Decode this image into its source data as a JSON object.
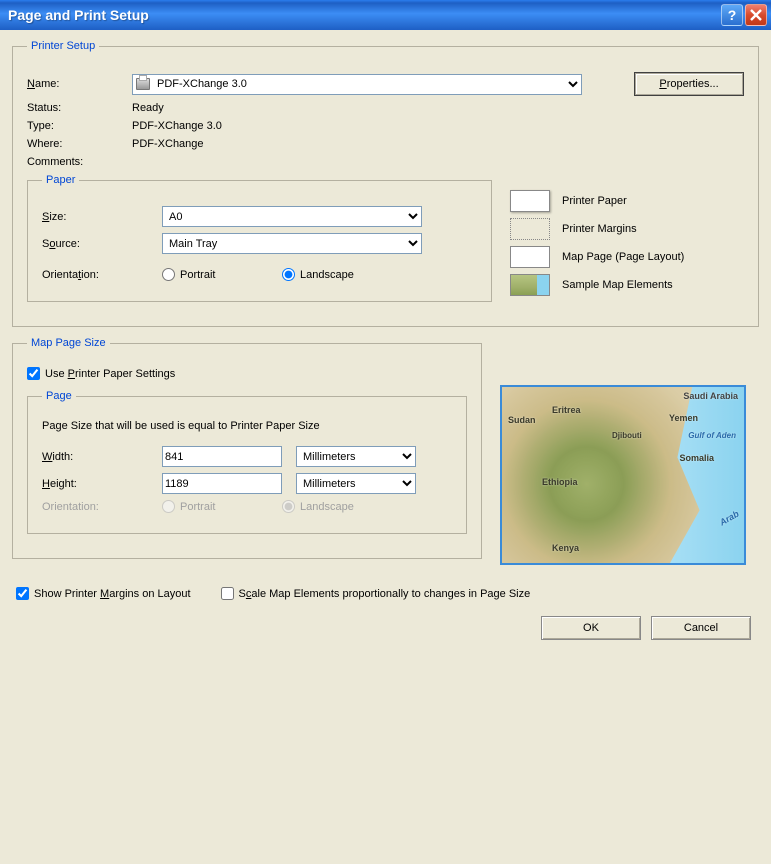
{
  "window": {
    "title": "Page and Print Setup"
  },
  "printer_setup": {
    "legend": "Printer Setup",
    "name_label": "Name:",
    "name_value": "PDF-XChange 3.0",
    "properties_button": "Properties...",
    "status_label": "Status:",
    "status_value": "Ready",
    "type_label": "Type:",
    "type_value": "PDF-XChange 3.0",
    "where_label": "Where:",
    "where_value": "PDF-XChange",
    "comments_label": "Comments:",
    "comments_value": ""
  },
  "paper": {
    "legend": "Paper",
    "size_label": "Size:",
    "size_value": "A0",
    "source_label": "Source:",
    "source_value": "Main Tray",
    "orientation_label": "Orientation:",
    "portrait_label": "Portrait",
    "landscape_label": "Landscape",
    "orientation_selected": "landscape"
  },
  "legend_panel": {
    "printer_paper": "Printer Paper",
    "printer_margins": "Printer Margins",
    "map_page": "Map Page (Page Layout)",
    "sample_map": "Sample Map Elements"
  },
  "map_page_size": {
    "legend": "Map Page Size",
    "use_printer_settings": "Use Printer Paper Settings",
    "use_printer_settings_checked": true,
    "page_legend": "Page",
    "page_hint": "Page Size that will be used is equal to Printer Paper Size",
    "width_label": "Width:",
    "width_value": "841",
    "width_unit": "Millimeters",
    "height_label": "Height:",
    "height_value": "1189",
    "height_unit": "Millimeters",
    "orientation_label": "Orientation:",
    "portrait_label": "Portrait",
    "landscape_label": "Landscape"
  },
  "map_preview": {
    "labels": [
      "Saudi Arabia",
      "Eritrea",
      "Sudan",
      "Yemen",
      "Djibouti",
      "Gulf of Aden",
      "Somalia",
      "Ethiopia",
      "Kenya",
      "Arab"
    ]
  },
  "bottom": {
    "show_margins_label": "Show Printer Margins on Layout",
    "show_margins_checked": true,
    "scale_elements_label": "Scale Map Elements proportionally to changes in Page Size",
    "scale_elements_checked": false,
    "ok": "OK",
    "cancel": "Cancel"
  },
  "underline_hints": {
    "name": "N",
    "size": "S",
    "source": "o",
    "orientation": "t",
    "properties": "P",
    "use_printer": "P",
    "width": "W",
    "height": "H",
    "show_margins": "M",
    "scale": "c"
  }
}
